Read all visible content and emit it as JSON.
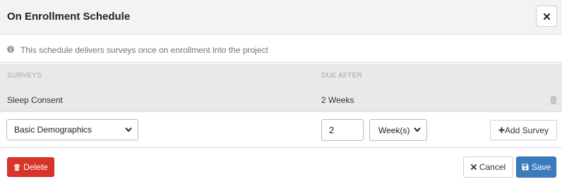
{
  "modal": {
    "title": "On Enrollment Schedule",
    "info_text": "This schedule delivers surveys once on enrollment into the project"
  },
  "table": {
    "columns": [
      "SURVEYS",
      "DUE AFTER"
    ],
    "rows": [
      {
        "survey": "Sleep Consent",
        "due_after": "2 Weeks"
      }
    ]
  },
  "add_form": {
    "survey_select_value": "Basic Demographics",
    "due_amount": "2",
    "due_unit_value": "Week(s)",
    "add_button_label": "Add Survey"
  },
  "footer": {
    "delete_label": "Delete",
    "cancel_label": "Cancel",
    "save_label": "Save"
  },
  "icons": {
    "close": "close-icon",
    "info": "info-icon",
    "trash": "trash-icon",
    "plus": "plus-icon",
    "times": "times-icon",
    "save": "floppy-disk-icon",
    "chevron": "chevron-down-icon"
  },
  "colors": {
    "delete_button": "#d9342b",
    "save_button": "#3a7cbc",
    "table_background": "#e9e9e9",
    "header_background": "#f3f3f3"
  }
}
